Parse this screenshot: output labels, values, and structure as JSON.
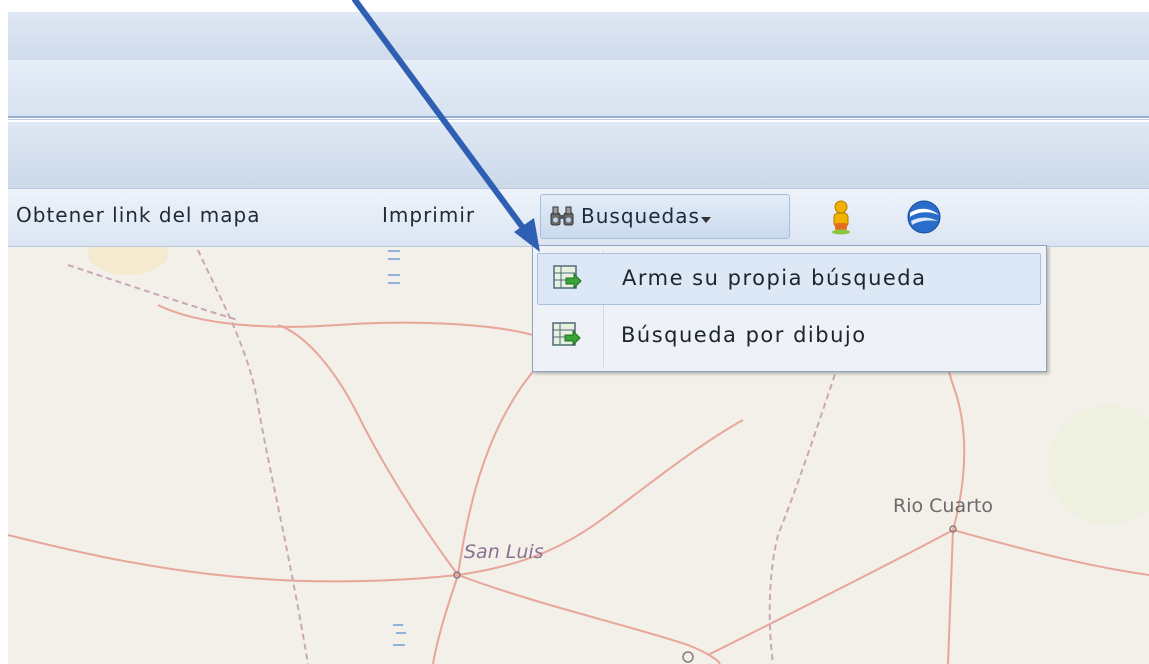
{
  "toolbar": {
    "get_link_label": "Obtener link del mapa",
    "print_label": "Imprimir",
    "searches_label": "Busquedas",
    "searches_dropdown_icon": "chevron-down-icon",
    "searches_icon": "binoculars-icon",
    "streetview_icon": "pegman-icon",
    "google_earth_icon": "google-earth-icon"
  },
  "searches_menu": {
    "items": [
      {
        "label": "Arme su propia búsqueda",
        "icon": "table-arrow-icon",
        "highlighted": true
      },
      {
        "label": "Búsqueda por dibujo",
        "icon": "table-arrow-icon",
        "highlighted": false
      }
    ]
  },
  "map": {
    "cities": [
      {
        "name": "San Luis"
      },
      {
        "name": "Rio Cuarto"
      }
    ]
  },
  "colors": {
    "annotation_arrow": "#2f5fb3",
    "map_background": "#f3efe9",
    "road": "#e8a69a"
  }
}
